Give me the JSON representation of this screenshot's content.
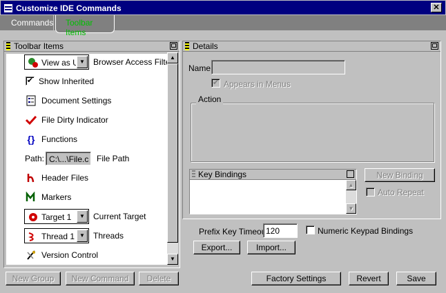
{
  "window": {
    "title": "Customize IDE Commands",
    "close": "✕"
  },
  "tabs": [
    {
      "label": "Commands"
    },
    {
      "label": "Toolbar Items"
    }
  ],
  "left_panel": {
    "title": "Toolbar Items",
    "items": [
      {
        "combo_value": "View as Us",
        "label": "Browser Access Filters"
      },
      {
        "label": "Show Inherited",
        "checked": "✔"
      },
      {
        "label": "Document Settings"
      },
      {
        "label": "File Dirty Indicator"
      },
      {
        "label": "Functions"
      },
      {
        "path_prefix": "Path:",
        "path_value": "C:\\...\\File.c",
        "label": "File Path"
      },
      {
        "label": "Header Files"
      },
      {
        "label": "Markers"
      },
      {
        "combo_value": "Target 1",
        "label": "Current Target"
      },
      {
        "combo_value": "Thread 1",
        "label": "Threads"
      },
      {
        "label": "Version Control"
      }
    ],
    "buttons": {
      "new_group": "New Group",
      "new_command": "New Command",
      "delete": "Delete"
    }
  },
  "details": {
    "title": "Details",
    "name_label": "Name:",
    "name_value": "",
    "appears_in_menus": "Appears in Menus",
    "appears_checked": "✔",
    "action_label": "Action",
    "key_bindings_title": "Key Bindings",
    "new_binding": "New Binding",
    "auto_repeat": "Auto Repeat"
  },
  "prefix": {
    "label": "Prefix Key Timeout:",
    "value": "120",
    "numeric_keypad": "Numeric Keypad Bindings"
  },
  "buttons": {
    "export": "Export...",
    "import": "Import...",
    "factory_settings": "Factory Settings",
    "revert": "Revert",
    "save": "Save"
  },
  "icons": {
    "combo_arrow": "▼",
    "scroll_up": "▲",
    "scroll_down": "▼"
  },
  "colors": {
    "titlebar": "#000080",
    "active_tab_text": "#00c000",
    "face": "#c0c0c0"
  }
}
